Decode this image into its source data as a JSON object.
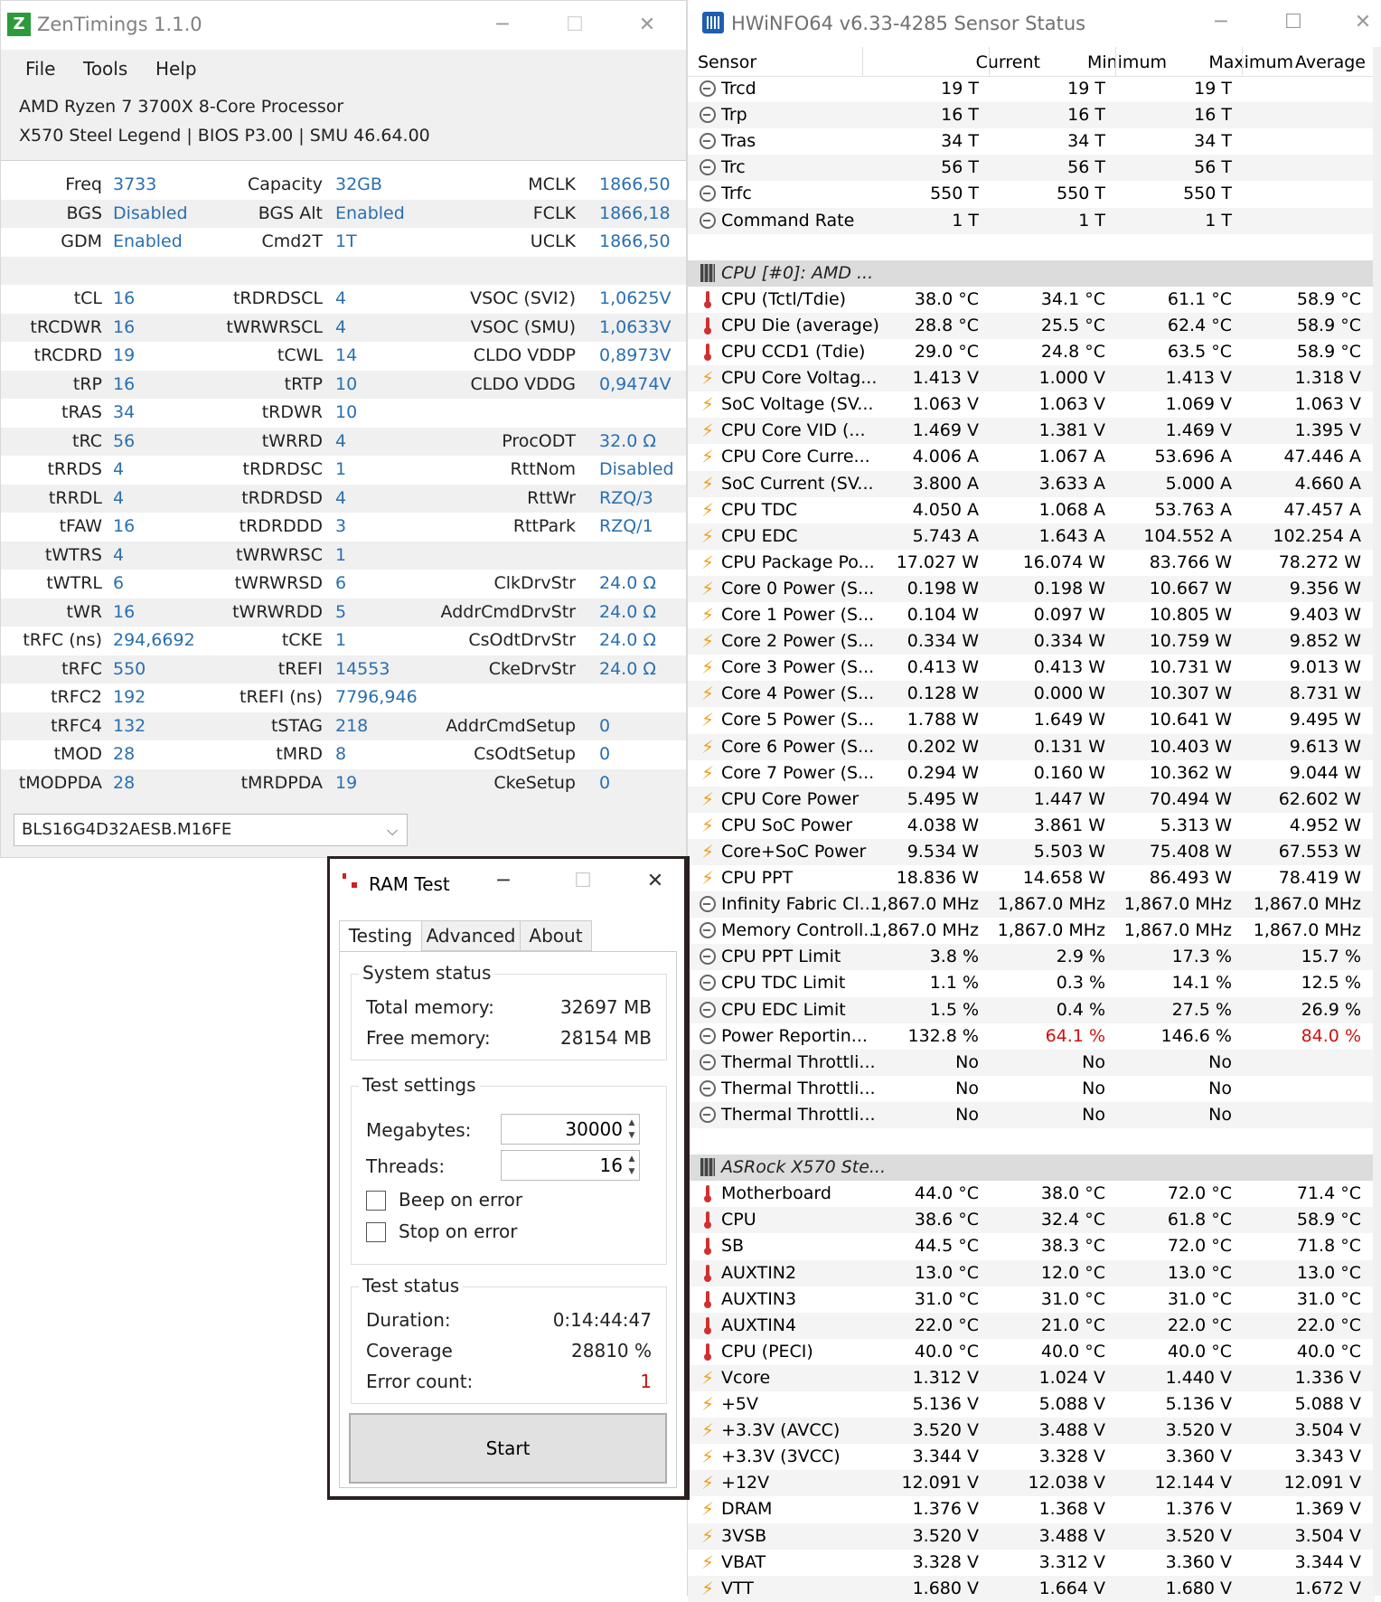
{
  "zentimings": {
    "title": "ZenTimings 1.1.0",
    "logo_letter": "Z",
    "menu": [
      "File",
      "Tools",
      "Help"
    ],
    "cpu": "AMD Ryzen 7 3700X 8-Core Processor",
    "board": "X570 Steel Legend | BIOS P3.00 | SMU 46.64.00",
    "rows": [
      [
        [
          "Freq",
          "3733"
        ],
        [
          "Capacity",
          "32GB"
        ],
        [
          "MCLK",
          "1866,50"
        ]
      ],
      [
        [
          "BGS",
          "Disabled"
        ],
        [
          "BGS Alt",
          "Enabled"
        ],
        [
          "FCLK",
          "1866,18"
        ]
      ],
      [
        [
          "GDM",
          "Enabled"
        ],
        [
          "Cmd2T",
          "1T"
        ],
        [
          "UCLK",
          "1866,50"
        ]
      ],
      [
        [
          "",
          ""
        ],
        [
          "",
          ""
        ],
        [
          "",
          ""
        ]
      ],
      [
        [
          "tCL",
          "16"
        ],
        [
          "tRDRDSCL",
          "4"
        ],
        [
          "VSOC (SVI2)",
          "1,0625V"
        ]
      ],
      [
        [
          "tRCDWR",
          "16"
        ],
        [
          "tWRWRSCL",
          "4"
        ],
        [
          "VSOC (SMU)",
          "1,0633V"
        ]
      ],
      [
        [
          "tRCDRD",
          "19"
        ],
        [
          "tCWL",
          "14"
        ],
        [
          "CLDO VDDP",
          "0,8973V"
        ]
      ],
      [
        [
          "tRP",
          "16"
        ],
        [
          "tRTP",
          "10"
        ],
        [
          "CLDO VDDG",
          "0,9474V"
        ]
      ],
      [
        [
          "tRAS",
          "34"
        ],
        [
          "tRDWR",
          "10"
        ],
        [
          "",
          ""
        ]
      ],
      [
        [
          "tRC",
          "56"
        ],
        [
          "tWRRD",
          "4"
        ],
        [
          "ProcODT",
          "32.0 Ω"
        ]
      ],
      [
        [
          "tRRDS",
          "4"
        ],
        [
          "tRDRDSC",
          "1"
        ],
        [
          "RttNom",
          "Disabled"
        ]
      ],
      [
        [
          "tRRDL",
          "4"
        ],
        [
          "tRDRDSD",
          "4"
        ],
        [
          "RttWr",
          "RZQ/3"
        ]
      ],
      [
        [
          "tFAW",
          "16"
        ],
        [
          "tRDRDDD",
          "3"
        ],
        [
          "RttPark",
          "RZQ/1"
        ]
      ],
      [
        [
          "tWTRS",
          "4"
        ],
        [
          "tWRWRSC",
          "1"
        ],
        [
          "",
          ""
        ]
      ],
      [
        [
          "tWTRL",
          "6"
        ],
        [
          "tWRWRSD",
          "6"
        ],
        [
          "ClkDrvStr",
          "24.0 Ω"
        ]
      ],
      [
        [
          "tWR",
          "16"
        ],
        [
          "tWRWRDD",
          "5"
        ],
        [
          "AddrCmdDrvStr",
          "24.0 Ω"
        ]
      ],
      [
        [
          "tRFC (ns)",
          "294,6692"
        ],
        [
          "tCKE",
          "1"
        ],
        [
          "CsOdtDrvStr",
          "24.0 Ω"
        ]
      ],
      [
        [
          "tRFC",
          "550"
        ],
        [
          "tREFI",
          "14553"
        ],
        [
          "CkeDrvStr",
          "24.0 Ω"
        ]
      ],
      [
        [
          "tRFC2",
          "192"
        ],
        [
          "tREFI (ns)",
          "7796,946"
        ],
        [
          "",
          ""
        ]
      ],
      [
        [
          "tRFC4",
          "132"
        ],
        [
          "tSTAG",
          "218"
        ],
        [
          "AddrCmdSetup",
          "0"
        ]
      ],
      [
        [
          "tMOD",
          "28"
        ],
        [
          "tMRD",
          "8"
        ],
        [
          "CsOdtSetup",
          "0"
        ]
      ],
      [
        [
          "tMODPDA",
          "28"
        ],
        [
          "tMRDPDA",
          "19"
        ],
        [
          "CkeSetup",
          "0"
        ]
      ]
    ],
    "module": "BLS16G4D32AESB.M16FE"
  },
  "hwinfo": {
    "title": "HWiNFO64 v6.33-4285 Sensor Status",
    "columns": [
      "Sensor",
      "Current",
      "Minimum",
      "Maximum",
      "Average"
    ],
    "rows": [
      {
        "icon": "clock",
        "name": "Trcd",
        "v": [
          "19 T",
          "19 T",
          "19 T",
          ""
        ]
      },
      {
        "icon": "clock",
        "name": "Trp",
        "v": [
          "16 T",
          "16 T",
          "16 T",
          ""
        ]
      },
      {
        "icon": "clock",
        "name": "Tras",
        "v": [
          "34 T",
          "34 T",
          "34 T",
          ""
        ]
      },
      {
        "icon": "clock",
        "name": "Trc",
        "v": [
          "56 T",
          "56 T",
          "56 T",
          ""
        ]
      },
      {
        "icon": "clock",
        "name": "Trfc",
        "v": [
          "550 T",
          "550 T",
          "550 T",
          ""
        ]
      },
      {
        "icon": "clock",
        "name": "Command Rate",
        "v": [
          "1 T",
          "1 T",
          "1 T",
          ""
        ]
      },
      {
        "icon": "blank",
        "name": "",
        "v": [
          "",
          "",
          "",
          ""
        ]
      },
      {
        "icon": "chip",
        "name": "CPU [#0]: AMD ...",
        "group": true,
        "v": [
          "",
          "",
          "",
          ""
        ]
      },
      {
        "icon": "therm",
        "name": "CPU (Tctl/Tdie)",
        "v": [
          "38.0 °C",
          "34.1 °C",
          "61.1 °C",
          "58.9 °C"
        ]
      },
      {
        "icon": "therm",
        "name": "CPU Die (average)",
        "v": [
          "28.8 °C",
          "25.5 °C",
          "62.4 °C",
          "58.9 °C"
        ]
      },
      {
        "icon": "therm",
        "name": "CPU CCD1 (Tdie)",
        "v": [
          "29.0 °C",
          "24.8 °C",
          "63.5 °C",
          "58.9 °C"
        ]
      },
      {
        "icon": "bolt",
        "name": "CPU Core Voltag...",
        "v": [
          "1.413 V",
          "1.000 V",
          "1.413 V",
          "1.318 V"
        ]
      },
      {
        "icon": "bolt",
        "name": "SoC Voltage (SV...",
        "v": [
          "1.063 V",
          "1.063 V",
          "1.069 V",
          "1.063 V"
        ]
      },
      {
        "icon": "bolt",
        "name": "CPU Core VID (...",
        "v": [
          "1.469 V",
          "1.381 V",
          "1.469 V",
          "1.395 V"
        ]
      },
      {
        "icon": "bolt",
        "name": "CPU Core Curre...",
        "v": [
          "4.006 A",
          "1.067 A",
          "53.696 A",
          "47.446 A"
        ]
      },
      {
        "icon": "bolt",
        "name": "SoC Current (SV...",
        "v": [
          "3.800 A",
          "3.633 A",
          "5.000 A",
          "4.660 A"
        ]
      },
      {
        "icon": "bolt",
        "name": "CPU TDC",
        "v": [
          "4.050 A",
          "1.068 A",
          "53.763 A",
          "47.457 A"
        ]
      },
      {
        "icon": "bolt",
        "name": "CPU EDC",
        "v": [
          "5.743 A",
          "1.643 A",
          "104.552 A",
          "102.254 A"
        ]
      },
      {
        "icon": "bolt",
        "name": "CPU Package Po...",
        "v": [
          "17.027 W",
          "16.074 W",
          "83.766 W",
          "78.272 W"
        ]
      },
      {
        "icon": "bolt",
        "name": "Core 0 Power (S...",
        "v": [
          "0.198 W",
          "0.198 W",
          "10.667 W",
          "9.356 W"
        ]
      },
      {
        "icon": "bolt",
        "name": "Core 1 Power (S...",
        "v": [
          "0.104 W",
          "0.097 W",
          "10.805 W",
          "9.403 W"
        ]
      },
      {
        "icon": "bolt",
        "name": "Core 2 Power (S...",
        "v": [
          "0.334 W",
          "0.334 W",
          "10.759 W",
          "9.852 W"
        ]
      },
      {
        "icon": "bolt",
        "name": "Core 3 Power (S...",
        "v": [
          "0.413 W",
          "0.413 W",
          "10.731 W",
          "9.013 W"
        ]
      },
      {
        "icon": "bolt",
        "name": "Core 4 Power (S...",
        "v": [
          "0.128 W",
          "0.000 W",
          "10.307 W",
          "8.731 W"
        ]
      },
      {
        "icon": "bolt",
        "name": "Core 5 Power (S...",
        "v": [
          "1.788 W",
          "1.649 W",
          "10.641 W",
          "9.495 W"
        ]
      },
      {
        "icon": "bolt",
        "name": "Core 6 Power (S...",
        "v": [
          "0.202 W",
          "0.131 W",
          "10.403 W",
          "9.613 W"
        ]
      },
      {
        "icon": "bolt",
        "name": "Core 7 Power (S...",
        "v": [
          "0.294 W",
          "0.160 W",
          "10.362 W",
          "9.044 W"
        ]
      },
      {
        "icon": "bolt",
        "name": "CPU Core Power",
        "v": [
          "5.495 W",
          "1.447 W",
          "70.494 W",
          "62.602 W"
        ]
      },
      {
        "icon": "bolt",
        "name": "CPU SoC Power",
        "v": [
          "4.038 W",
          "3.861 W",
          "5.313 W",
          "4.952 W"
        ]
      },
      {
        "icon": "bolt",
        "name": "Core+SoC Power",
        "v": [
          "9.534 W",
          "5.503 W",
          "75.408 W",
          "67.553 W"
        ]
      },
      {
        "icon": "bolt",
        "name": "CPU PPT",
        "v": [
          "18.836 W",
          "14.658 W",
          "86.493 W",
          "78.419 W"
        ]
      },
      {
        "icon": "clock",
        "name": "Infinity Fabric Cl...",
        "v": [
          "1,867.0 MHz",
          "1,867.0 MHz",
          "1,867.0 MHz",
          "1,867.0 MHz"
        ]
      },
      {
        "icon": "clock",
        "name": "Memory Controll...",
        "v": [
          "1,867.0 MHz",
          "1,867.0 MHz",
          "1,867.0 MHz",
          "1,867.0 MHz"
        ]
      },
      {
        "icon": "clock",
        "name": "CPU PPT Limit",
        "v": [
          "3.8 %",
          "2.9 %",
          "17.3 %",
          "15.7 %"
        ]
      },
      {
        "icon": "clock",
        "name": "CPU TDC Limit",
        "v": [
          "1.1 %",
          "0.3 %",
          "14.1 %",
          "12.5 %"
        ]
      },
      {
        "icon": "clock",
        "name": "CPU EDC Limit",
        "v": [
          "1.5 %",
          "0.4 %",
          "27.5 %",
          "26.9 %"
        ]
      },
      {
        "icon": "clock",
        "name": "Power Reportin...",
        "v": [
          "132.8 %",
          "64.1 %",
          "146.6 %",
          "84.0 %"
        ],
        "red": [
          1,
          3
        ]
      },
      {
        "icon": "clock",
        "name": "Thermal Throttli...",
        "v": [
          "No",
          "No",
          "No",
          ""
        ]
      },
      {
        "icon": "clock",
        "name": "Thermal Throttli...",
        "v": [
          "No",
          "No",
          "No",
          ""
        ]
      },
      {
        "icon": "clock",
        "name": "Thermal Throttli...",
        "v": [
          "No",
          "No",
          "No",
          ""
        ]
      },
      {
        "icon": "blank",
        "name": "",
        "v": [
          "",
          "",
          "",
          ""
        ]
      },
      {
        "icon": "chip",
        "name": "ASRock X570 Ste...",
        "group": true,
        "v": [
          "",
          "",
          "",
          ""
        ]
      },
      {
        "icon": "therm",
        "name": "Motherboard",
        "v": [
          "44.0 °C",
          "38.0 °C",
          "72.0 °C",
          "71.4 °C"
        ]
      },
      {
        "icon": "therm",
        "name": "CPU",
        "v": [
          "38.6 °C",
          "32.4 °C",
          "61.8 °C",
          "58.9 °C"
        ]
      },
      {
        "icon": "therm",
        "name": "SB",
        "v": [
          "44.5 °C",
          "38.3 °C",
          "72.0 °C",
          "71.8 °C"
        ]
      },
      {
        "icon": "therm",
        "name": "AUXTIN2",
        "v": [
          "13.0 °C",
          "12.0 °C",
          "13.0 °C",
          "13.0 °C"
        ]
      },
      {
        "icon": "therm",
        "name": "AUXTIN3",
        "v": [
          "31.0 °C",
          "31.0 °C",
          "31.0 °C",
          "31.0 °C"
        ]
      },
      {
        "icon": "therm",
        "name": "AUXTIN4",
        "v": [
          "22.0 °C",
          "21.0 °C",
          "22.0 °C",
          "22.0 °C"
        ]
      },
      {
        "icon": "therm",
        "name": "CPU (PECI)",
        "v": [
          "40.0 °C",
          "40.0 °C",
          "40.0 °C",
          "40.0 °C"
        ]
      },
      {
        "icon": "bolt",
        "name": "Vcore",
        "v": [
          "1.312 V",
          "1.024 V",
          "1.440 V",
          "1.336 V"
        ]
      },
      {
        "icon": "bolt",
        "name": "+5V",
        "v": [
          "5.136 V",
          "5.088 V",
          "5.136 V",
          "5.088 V"
        ]
      },
      {
        "icon": "bolt",
        "name": "+3.3V (AVCC)",
        "v": [
          "3.520 V",
          "3.488 V",
          "3.520 V",
          "3.504 V"
        ]
      },
      {
        "icon": "bolt",
        "name": "+3.3V (3VCC)",
        "v": [
          "3.344 V",
          "3.328 V",
          "3.360 V",
          "3.343 V"
        ]
      },
      {
        "icon": "bolt",
        "name": "+12V",
        "v": [
          "12.091 V",
          "12.038 V",
          "12.144 V",
          "12.091 V"
        ]
      },
      {
        "icon": "bolt",
        "name": "DRAM",
        "v": [
          "1.376 V",
          "1.368 V",
          "1.376 V",
          "1.369 V"
        ]
      },
      {
        "icon": "bolt",
        "name": "3VSB",
        "v": [
          "3.520 V",
          "3.488 V",
          "3.520 V",
          "3.504 V"
        ]
      },
      {
        "icon": "bolt",
        "name": "VBAT",
        "v": [
          "3.328 V",
          "3.312 V",
          "3.360 V",
          "3.344 V"
        ]
      },
      {
        "icon": "bolt",
        "name": "VTT",
        "v": [
          "1.680 V",
          "1.664 V",
          "1.680 V",
          "1.672 V"
        ]
      }
    ]
  },
  "ramtest": {
    "title": "RAM Test",
    "tabs": [
      "Testing",
      "Advanced",
      "About"
    ],
    "system_status": {
      "label": "System status",
      "total_label": "Total memory:",
      "total": "32697 MB",
      "free_label": "Free memory:",
      "free": "28154 MB"
    },
    "test_settings": {
      "label": "Test settings",
      "mb_label": "Megabytes:",
      "mb": "30000",
      "threads_label": "Threads:",
      "threads": "16",
      "beep": "Beep on error",
      "stop": "Stop on error"
    },
    "test_status": {
      "label": "Test status",
      "duration_label": "Duration:",
      "duration": "0:14:44:47",
      "coverage_label": "Coverage",
      "coverage": "28810 %",
      "errors_label": "Error count:",
      "errors": "1"
    },
    "start": "Start"
  },
  "icons": {
    "minimize": "─",
    "maximize": "☐",
    "close": "✕",
    "bolt": "⚡",
    "chevron": "⌵"
  }
}
